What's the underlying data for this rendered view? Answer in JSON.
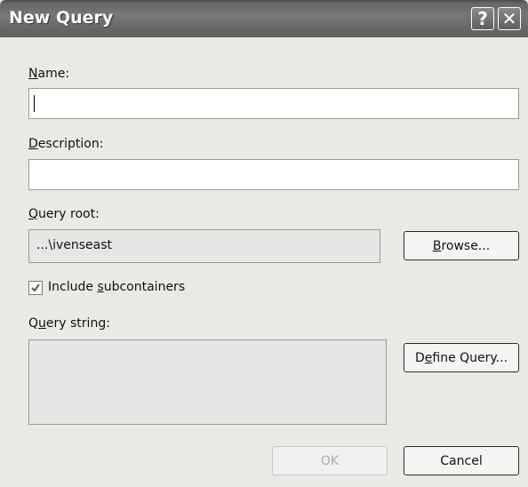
{
  "window": {
    "title": "New Query",
    "help_label": "?",
    "close_label": "✕"
  },
  "form": {
    "name": {
      "label_mnemonic": "N",
      "label_rest": "ame:",
      "value": ""
    },
    "description": {
      "label_mnemonic": "D",
      "label_rest": "escription:",
      "value": ""
    },
    "query_root": {
      "label_mnemonic": "Q",
      "label_rest": "uery root:",
      "value": "...\\ivenseast"
    },
    "browse_button": {
      "mnemonic": "B",
      "rest": "rowse..."
    },
    "include_subcontainers": {
      "prefix": "Include ",
      "mnemonic": "s",
      "rest": "ubcontainers",
      "checked": true
    },
    "query_string": {
      "label_prefix": "Q",
      "label_mnemonic": "u",
      "label_rest": "ery string:",
      "value": ""
    },
    "define_query_button": {
      "prefix": "D",
      "mnemonic": "e",
      "rest": "fine Query..."
    }
  },
  "buttons": {
    "ok": "OK",
    "cancel": "Cancel"
  }
}
